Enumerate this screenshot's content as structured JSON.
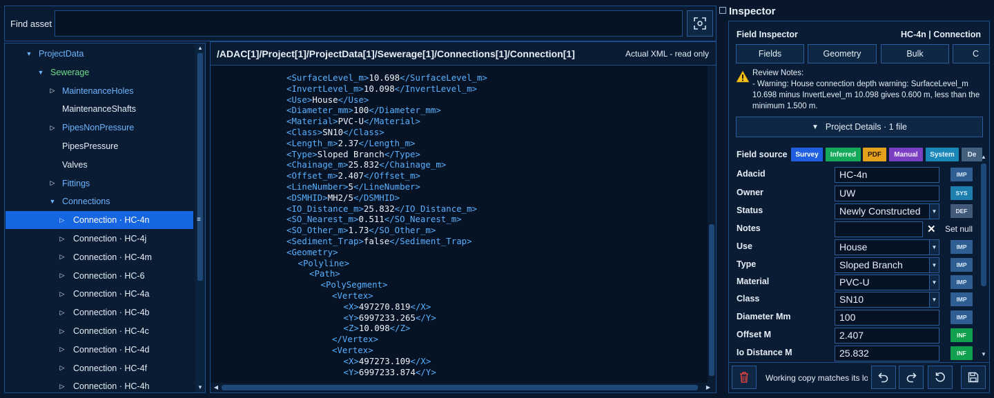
{
  "find": {
    "label": "Find asset",
    "placeholder": ""
  },
  "tree": {
    "items": [
      {
        "label": "ProjectData",
        "indent": 0,
        "caret": "down",
        "color": "blue",
        "selected": false
      },
      {
        "label": "Sewerage",
        "indent": 1,
        "caret": "down",
        "color": "green",
        "selected": false
      },
      {
        "label": "MaintenanceHoles",
        "indent": 2,
        "caret": "right",
        "color": "blue",
        "selected": false
      },
      {
        "label": "MaintenanceShafts",
        "indent": 2,
        "caret": "none",
        "color": "white",
        "selected": false
      },
      {
        "label": "PipesNonPressure",
        "indent": 2,
        "caret": "right",
        "color": "blue",
        "selected": false
      },
      {
        "label": "PipesPressure",
        "indent": 2,
        "caret": "none",
        "color": "white",
        "selected": false
      },
      {
        "label": "Valves",
        "indent": 2,
        "caret": "none",
        "color": "white",
        "selected": false
      },
      {
        "label": "Fittings",
        "indent": 2,
        "caret": "right",
        "color": "blue",
        "selected": false
      },
      {
        "label": "Connections",
        "indent": 2,
        "caret": "down",
        "color": "blue",
        "selected": false
      },
      {
        "label": "Connection · HC-4n",
        "indent": 3,
        "caret": "right",
        "color": "white",
        "selected": true
      },
      {
        "label": "Connection · HC-4j",
        "indent": 3,
        "caret": "right",
        "color": "white",
        "selected": false
      },
      {
        "label": "Connection · HC-4m",
        "indent": 3,
        "caret": "right",
        "color": "white",
        "selected": false
      },
      {
        "label": "Connection · HC-6",
        "indent": 3,
        "caret": "right",
        "color": "white",
        "selected": false
      },
      {
        "label": "Connection · HC-4a",
        "indent": 3,
        "caret": "right",
        "color": "white",
        "selected": false
      },
      {
        "label": "Connection · HC-4b",
        "indent": 3,
        "caret": "right",
        "color": "white",
        "selected": false
      },
      {
        "label": "Connection · HC-4c",
        "indent": 3,
        "caret": "right",
        "color": "white",
        "selected": false
      },
      {
        "label": "Connection · HC-4d",
        "indent": 3,
        "caret": "right",
        "color": "white",
        "selected": false
      },
      {
        "label": "Connection · HC-4f",
        "indent": 3,
        "caret": "right",
        "color": "white",
        "selected": false
      },
      {
        "label": "Connection · HC-4h",
        "indent": 3,
        "caret": "right",
        "color": "white",
        "selected": false
      }
    ]
  },
  "xml": {
    "path": "/ADAC[1]/Project[1]/ProjectData[1]/Sewerage[1]/Connections[1]/Connection[1]",
    "mode": "Actual XML - read only",
    "lines": [
      {
        "indent": 6,
        "tag": "SurfaceLevel_m",
        "value": "10.698"
      },
      {
        "indent": 6,
        "tag": "InvertLevel_m",
        "value": "10.098"
      },
      {
        "indent": 6,
        "tag": "Use",
        "value": "House"
      },
      {
        "indent": 6,
        "tag": "Diameter_mm",
        "value": "100"
      },
      {
        "indent": 6,
        "tag": "Material",
        "value": "PVC-U"
      },
      {
        "indent": 6,
        "tag": "Class",
        "value": "SN10"
      },
      {
        "indent": 6,
        "tag": "Length_m",
        "value": "2.37"
      },
      {
        "indent": 6,
        "tag": "Type",
        "value": "Sloped Branch"
      },
      {
        "indent": 6,
        "tag": "Chainage_m",
        "value": "25.832"
      },
      {
        "indent": 6,
        "tag": "Offset_m",
        "value": "2.407"
      },
      {
        "indent": 6,
        "tag": "LineNumber",
        "value": "5"
      },
      {
        "indent": 6,
        "tag": "DSMHID",
        "value": "MH2/5"
      },
      {
        "indent": 6,
        "tag": "IO_Distance_m",
        "value": "25.832"
      },
      {
        "indent": 6,
        "tag": "SO_Nearest_m",
        "value": "0.511"
      },
      {
        "indent": 6,
        "tag": "SO_Other_m",
        "value": "1.73"
      },
      {
        "indent": 6,
        "tag": "Sediment_Trap",
        "value": "false"
      },
      {
        "indent": 6,
        "tag": "Geometry",
        "open": true
      },
      {
        "indent": 7,
        "tag": "Polyline",
        "open": true
      },
      {
        "indent": 8,
        "tag": "Path",
        "open": true
      },
      {
        "indent": 9,
        "tag": "PolySegment",
        "open": true
      },
      {
        "indent": 10,
        "tag": "Vertex",
        "open": true
      },
      {
        "indent": 11,
        "tag": "X",
        "value": "497270.819"
      },
      {
        "indent": 11,
        "tag": "Y",
        "value": "6997233.265"
      },
      {
        "indent": 11,
        "tag": "Z",
        "value": "10.098"
      },
      {
        "indent": 10,
        "tag": "Vertex",
        "close": true
      },
      {
        "indent": 10,
        "tag": "Vertex",
        "open": true
      },
      {
        "indent": 11,
        "tag": "X",
        "value": "497273.109"
      },
      {
        "indent": 11,
        "tag": "Y",
        "value": "6997233.874"
      }
    ]
  },
  "inspector": {
    "title": "Inspector",
    "field_inspector_label": "Field Inspector",
    "asset_label": "HC-4n | Connection",
    "tabs": [
      "Fields",
      "Geometry",
      "Bulk",
      "C"
    ],
    "review_title": "Review Notes:",
    "review_text": "- Warning: House connection depth warning: SurfaceLevel_m 10.698 minus InvertLevel_m 10.098 gives 0.600 m, less than the minimum 1.500 m.",
    "project_details": "Project Details · 1 file",
    "field_source_label": "Field source",
    "sources": [
      {
        "label": "Survey",
        "bg": "#1f5fe0",
        "fg": "#ffffff"
      },
      {
        "label": "Inferred",
        "bg": "#13a85a",
        "fg": "#e8fff0"
      },
      {
        "label": "PDF",
        "bg": "#e3a21a",
        "fg": "#2a1a00"
      },
      {
        "label": "Manual",
        "bg": "#7b3fc4",
        "fg": "#f3eaff"
      },
      {
        "label": "System",
        "bg": "#1b86b8",
        "fg": "#e0f4ff"
      },
      {
        "label": "De",
        "bg": "#44607f",
        "fg": "#e0ebf6"
      }
    ],
    "fields": [
      {
        "label": "Adacid",
        "value": "HC-4n",
        "kind": "text",
        "src": "IMP"
      },
      {
        "label": "Owner",
        "value": "UW",
        "kind": "text",
        "src": "SYS"
      },
      {
        "label": "Status",
        "value": "Newly Constructed",
        "kind": "select",
        "src": "DEF"
      },
      {
        "label": "Notes",
        "value": "",
        "kind": "notes",
        "src": ""
      },
      {
        "label": "Use",
        "value": "House",
        "kind": "select",
        "src": "IMP"
      },
      {
        "label": "Type",
        "value": "Sloped Branch",
        "kind": "select",
        "src": "IMP"
      },
      {
        "label": "Material",
        "value": "PVC-U",
        "kind": "select",
        "src": "IMP"
      },
      {
        "label": "Class",
        "value": "SN10",
        "kind": "select",
        "src": "IMP"
      },
      {
        "label": "Diameter Mm",
        "value": "100",
        "kind": "text",
        "src": "IMP"
      },
      {
        "label": "Offset M",
        "value": "2.407",
        "kind": "text",
        "src": "INF"
      },
      {
        "label": "Io Distance M",
        "value": "25.832",
        "kind": "text",
        "src": "INF"
      }
    ],
    "set_null_label": "Set null",
    "footer_status": "Working copy matches its loaded file"
  }
}
